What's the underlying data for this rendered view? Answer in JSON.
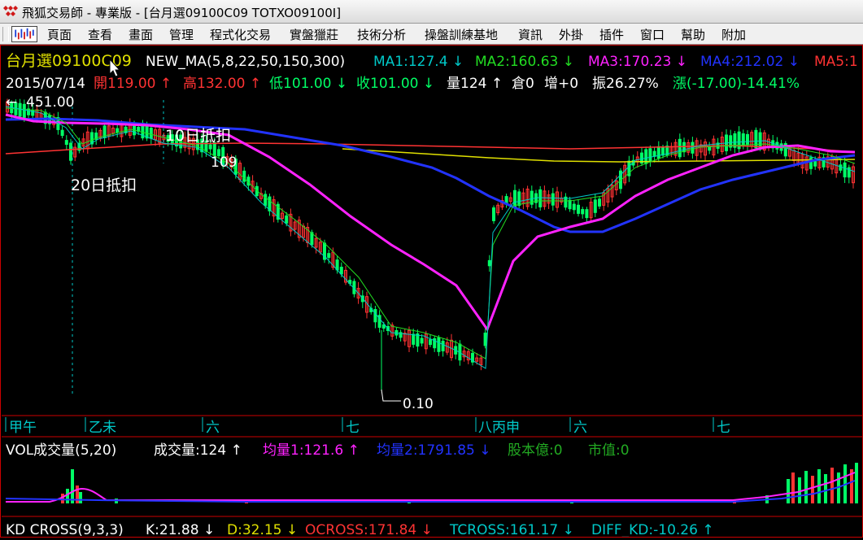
{
  "window": {
    "title": "飛狐交易師 - 專業版 - [台月選09100C09 TOTXO09100I]"
  },
  "menu": {
    "items": [
      "頁面",
      "查看",
      "畫面",
      "管理",
      "程式化交易",
      "實盤獵莊",
      "技術分析",
      "操盤訓練基地",
      "資訊",
      "外掛",
      "插件",
      "窗口",
      "幫助",
      "附加"
    ]
  },
  "colors": {
    "ma1": "#00c8c8",
    "ma2": "#22dd22",
    "ma3": "#ff22ff",
    "ma4": "#2233ff",
    "ma5": "#ff3333",
    "up": "#ff3333",
    "down": "#00ff66",
    "long_ma": "#e0e000"
  },
  "price_panel": {
    "header1": {
      "symbol": "台月選09100C09",
      "indicator": "NEW_MA(5,8,22,50,150,300)",
      "ma1": "MA1:127.4 ↓",
      "ma2": "MA2:160.63 ↓",
      "ma3": "MA3:170.23 ↓",
      "ma4": "MA4:212.02 ↓",
      "ma5": "MA5:1"
    },
    "header2": {
      "date": "2015/07/14",
      "open": "開119.00 ↑",
      "high": "高132.00 ↑",
      "low": "低101.00 ↓",
      "close": "收101.00 ↓",
      "volume": "量124 ↑",
      "oi": "倉0",
      "oi_change": "增+0",
      "amplitude": "振26.27%",
      "change": "漲(-17.00)-14.41%"
    },
    "annotations": {
      "max_price": "451.00",
      "min_price": "0.10",
      "deduct_10": "10日抵扣",
      "deduct_20": "20日抵扣",
      "value_109": "109"
    },
    "time_axis": [
      "甲午",
      "乙未",
      "六",
      "七",
      "八丙申",
      "六",
      "七"
    ]
  },
  "volume_panel": {
    "label": "VOL成交量(5,20)",
    "vol": "成交量:124 ↑",
    "ma1": "均量1:121.6 ↑",
    "ma2": "均量2:1791.85 ↓",
    "shares": "股本億:0",
    "mcap": "市值:0"
  },
  "kd_panel": {
    "label": "KD CROSS(9,3,3)",
    "k": "K:21.88 ↓",
    "d": "D:32.15 ↓",
    "ocross": "OCROSS:171.84 ↓",
    "tcross": "TCROSS:161.17 ↓",
    "diff": "DIFF_KD:-10.26 ↑"
  }
}
